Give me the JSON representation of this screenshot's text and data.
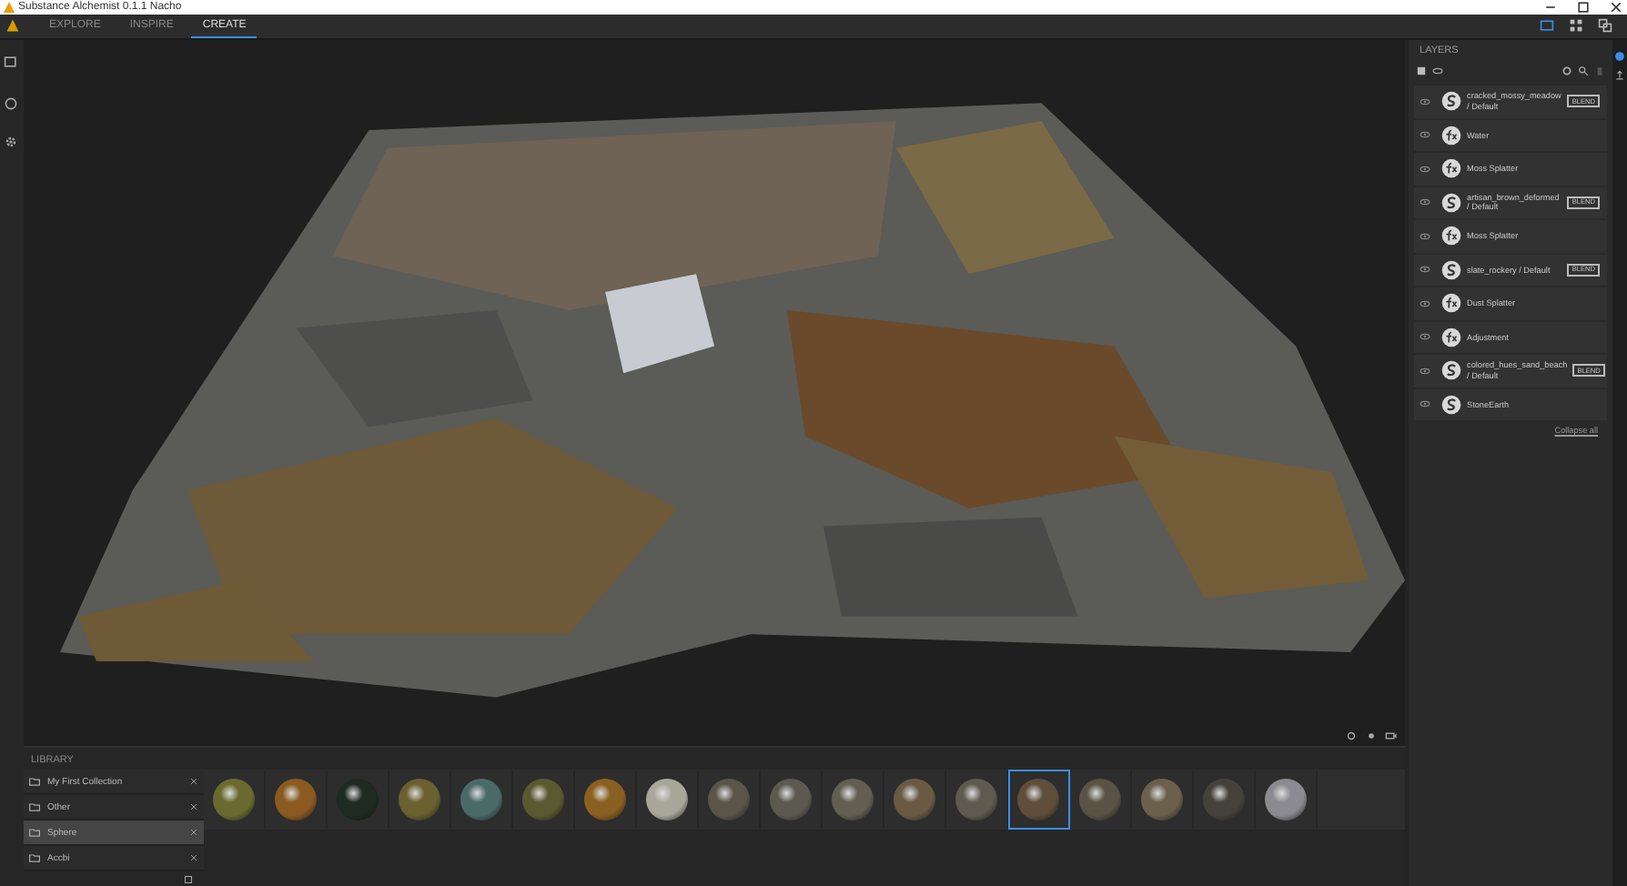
{
  "window": {
    "title": "Substance Alchemist 0.1.1 Nacho"
  },
  "tabs": [
    {
      "label": "EXPLORE",
      "selected": false
    },
    {
      "label": "INSPIRE",
      "selected": false
    },
    {
      "label": "CREATE",
      "selected": true
    }
  ],
  "layers": {
    "title": "LAYERS",
    "footer": "Collapse all",
    "items": [
      {
        "kind": "material",
        "name": "cracked_mossy_meadow / Default",
        "badge": "BLEND"
      },
      {
        "kind": "filter",
        "name": "Water"
      },
      {
        "kind": "filter",
        "name": "Moss Splatter"
      },
      {
        "kind": "material",
        "name": "artisan_brown_deformed / Default",
        "badge": "BLEND"
      },
      {
        "kind": "filter",
        "name": "Moss Splatter"
      },
      {
        "kind": "material",
        "name": "slate_rockery / Default",
        "badge": "BLEND"
      },
      {
        "kind": "filter",
        "name": "Dust Splatter"
      },
      {
        "kind": "filter",
        "name": "Adjustment"
      },
      {
        "kind": "material",
        "name": "colored_hues_sand_beach / Default",
        "badge": "BLEND"
      },
      {
        "kind": "material",
        "name": "StoneEarth"
      }
    ]
  },
  "library": {
    "title": "LIBRARY",
    "collections": [
      {
        "name": "My First Collection",
        "selected": false
      },
      {
        "name": "Other",
        "selected": false
      },
      {
        "name": "Sphere",
        "selected": true
      },
      {
        "name": "Accbi",
        "selected": false
      }
    ],
    "materials": [
      {
        "color": "#6a6a30",
        "selected": false
      },
      {
        "color": "#8a5a20",
        "selected": false
      },
      {
        "color": "#1e2a22",
        "selected": false
      },
      {
        "color": "#6a6030",
        "selected": false
      },
      {
        "color": "#4a6a68",
        "selected": false
      },
      {
        "color": "#5a5a30",
        "selected": false
      },
      {
        "color": "#8a6020",
        "selected": false
      },
      {
        "color": "#a8a89a",
        "selected": false
      },
      {
        "color": "#5a5548",
        "selected": false
      },
      {
        "color": "#5c5a50",
        "selected": false
      },
      {
        "color": "#625e52",
        "selected": false
      },
      {
        "color": "#6a5a44",
        "selected": false
      },
      {
        "color": "#5e5a50",
        "selected": false
      },
      {
        "color": "#5e4e3a",
        "selected": true
      },
      {
        "color": "#5a5244",
        "selected": false
      },
      {
        "color": "#6a604c",
        "selected": false
      },
      {
        "color": "#44423a",
        "selected": false
      },
      {
        "color": "#8a8a90",
        "selected": false
      }
    ]
  }
}
